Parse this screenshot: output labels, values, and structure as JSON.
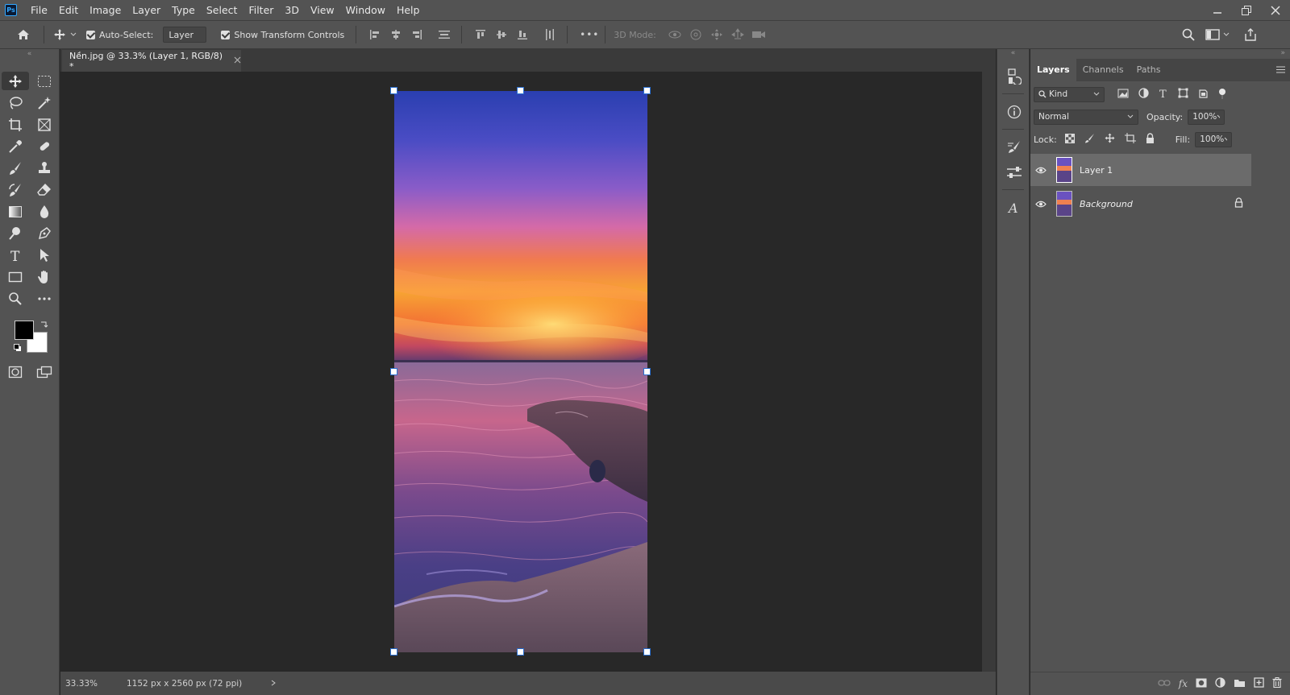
{
  "app": {
    "logo": "Ps"
  },
  "menu": [
    "File",
    "Edit",
    "Image",
    "Layer",
    "Type",
    "Select",
    "Filter",
    "3D",
    "View",
    "Window",
    "Help"
  ],
  "options": {
    "auto_select_label": "Auto-Select:",
    "auto_select_target": "Layer",
    "show_transform_label": "Show Transform Controls",
    "mode_3d_label": "3D Mode:",
    "more": "•••"
  },
  "document": {
    "tab_title": "Nền.jpg @ 33.3% (Layer 1, RGB/8) *",
    "zoom": "33.33%",
    "info": "1152 px x 2560 px (72 ppi)"
  },
  "layers_panel": {
    "tabs": [
      "Layers",
      "Channels",
      "Paths"
    ],
    "filter_kind": "Kind",
    "blend_mode": "Normal",
    "opacity_label": "Opacity:",
    "opacity_value": "100%",
    "lock_label": "Lock:",
    "fill_label": "Fill:",
    "fill_value": "100%",
    "layers": [
      {
        "name": "Layer 1",
        "selected": true,
        "locked": false
      },
      {
        "name": "Background",
        "selected": false,
        "locked": true
      }
    ]
  },
  "colors": {
    "foreground": "#000000",
    "background": "#ffffff",
    "accent": "#31a8ff"
  }
}
